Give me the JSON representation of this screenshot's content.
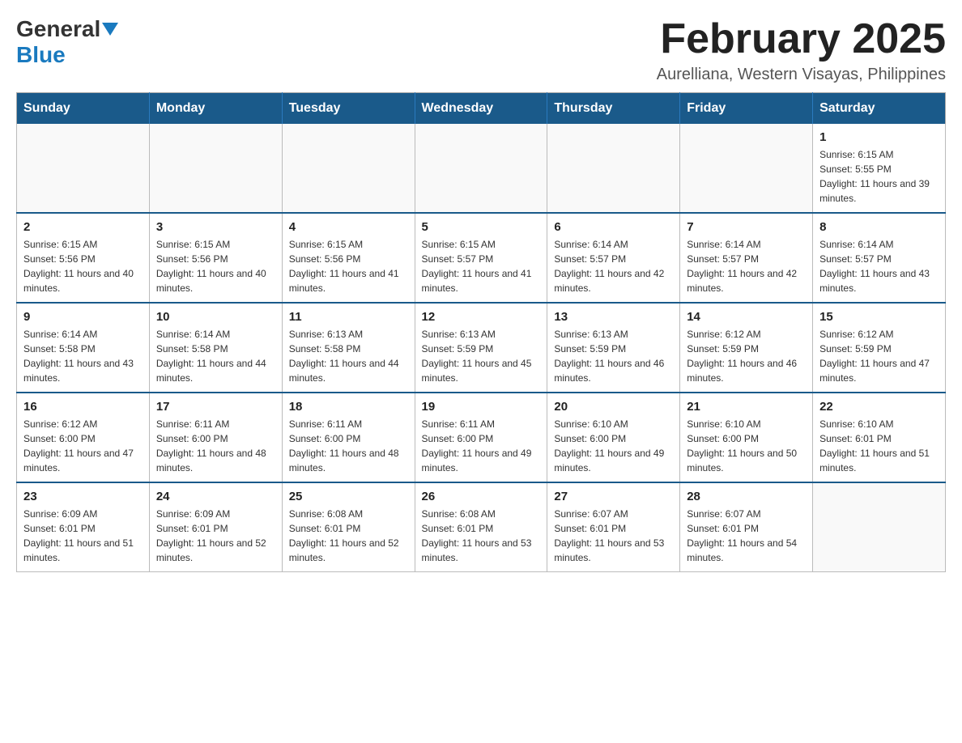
{
  "header": {
    "logo_general": "General",
    "logo_blue": "Blue",
    "month_title": "February 2025",
    "location": "Aurelliana, Western Visayas, Philippines"
  },
  "days_of_week": [
    "Sunday",
    "Monday",
    "Tuesday",
    "Wednesday",
    "Thursday",
    "Friday",
    "Saturday"
  ],
  "weeks": [
    [
      {
        "day": "",
        "info": ""
      },
      {
        "day": "",
        "info": ""
      },
      {
        "day": "",
        "info": ""
      },
      {
        "day": "",
        "info": ""
      },
      {
        "day": "",
        "info": ""
      },
      {
        "day": "",
        "info": ""
      },
      {
        "day": "1",
        "info": "Sunrise: 6:15 AM\nSunset: 5:55 PM\nDaylight: 11 hours and 39 minutes."
      }
    ],
    [
      {
        "day": "2",
        "info": "Sunrise: 6:15 AM\nSunset: 5:56 PM\nDaylight: 11 hours and 40 minutes."
      },
      {
        "day": "3",
        "info": "Sunrise: 6:15 AM\nSunset: 5:56 PM\nDaylight: 11 hours and 40 minutes."
      },
      {
        "day": "4",
        "info": "Sunrise: 6:15 AM\nSunset: 5:56 PM\nDaylight: 11 hours and 41 minutes."
      },
      {
        "day": "5",
        "info": "Sunrise: 6:15 AM\nSunset: 5:57 PM\nDaylight: 11 hours and 41 minutes."
      },
      {
        "day": "6",
        "info": "Sunrise: 6:14 AM\nSunset: 5:57 PM\nDaylight: 11 hours and 42 minutes."
      },
      {
        "day": "7",
        "info": "Sunrise: 6:14 AM\nSunset: 5:57 PM\nDaylight: 11 hours and 42 minutes."
      },
      {
        "day": "8",
        "info": "Sunrise: 6:14 AM\nSunset: 5:57 PM\nDaylight: 11 hours and 43 minutes."
      }
    ],
    [
      {
        "day": "9",
        "info": "Sunrise: 6:14 AM\nSunset: 5:58 PM\nDaylight: 11 hours and 43 minutes."
      },
      {
        "day": "10",
        "info": "Sunrise: 6:14 AM\nSunset: 5:58 PM\nDaylight: 11 hours and 44 minutes."
      },
      {
        "day": "11",
        "info": "Sunrise: 6:13 AM\nSunset: 5:58 PM\nDaylight: 11 hours and 44 minutes."
      },
      {
        "day": "12",
        "info": "Sunrise: 6:13 AM\nSunset: 5:59 PM\nDaylight: 11 hours and 45 minutes."
      },
      {
        "day": "13",
        "info": "Sunrise: 6:13 AM\nSunset: 5:59 PM\nDaylight: 11 hours and 46 minutes."
      },
      {
        "day": "14",
        "info": "Sunrise: 6:12 AM\nSunset: 5:59 PM\nDaylight: 11 hours and 46 minutes."
      },
      {
        "day": "15",
        "info": "Sunrise: 6:12 AM\nSunset: 5:59 PM\nDaylight: 11 hours and 47 minutes."
      }
    ],
    [
      {
        "day": "16",
        "info": "Sunrise: 6:12 AM\nSunset: 6:00 PM\nDaylight: 11 hours and 47 minutes."
      },
      {
        "day": "17",
        "info": "Sunrise: 6:11 AM\nSunset: 6:00 PM\nDaylight: 11 hours and 48 minutes."
      },
      {
        "day": "18",
        "info": "Sunrise: 6:11 AM\nSunset: 6:00 PM\nDaylight: 11 hours and 48 minutes."
      },
      {
        "day": "19",
        "info": "Sunrise: 6:11 AM\nSunset: 6:00 PM\nDaylight: 11 hours and 49 minutes."
      },
      {
        "day": "20",
        "info": "Sunrise: 6:10 AM\nSunset: 6:00 PM\nDaylight: 11 hours and 49 minutes."
      },
      {
        "day": "21",
        "info": "Sunrise: 6:10 AM\nSunset: 6:00 PM\nDaylight: 11 hours and 50 minutes."
      },
      {
        "day": "22",
        "info": "Sunrise: 6:10 AM\nSunset: 6:01 PM\nDaylight: 11 hours and 51 minutes."
      }
    ],
    [
      {
        "day": "23",
        "info": "Sunrise: 6:09 AM\nSunset: 6:01 PM\nDaylight: 11 hours and 51 minutes."
      },
      {
        "day": "24",
        "info": "Sunrise: 6:09 AM\nSunset: 6:01 PM\nDaylight: 11 hours and 52 minutes."
      },
      {
        "day": "25",
        "info": "Sunrise: 6:08 AM\nSunset: 6:01 PM\nDaylight: 11 hours and 52 minutes."
      },
      {
        "day": "26",
        "info": "Sunrise: 6:08 AM\nSunset: 6:01 PM\nDaylight: 11 hours and 53 minutes."
      },
      {
        "day": "27",
        "info": "Sunrise: 6:07 AM\nSunset: 6:01 PM\nDaylight: 11 hours and 53 minutes."
      },
      {
        "day": "28",
        "info": "Sunrise: 6:07 AM\nSunset: 6:01 PM\nDaylight: 11 hours and 54 minutes."
      },
      {
        "day": "",
        "info": ""
      }
    ]
  ]
}
